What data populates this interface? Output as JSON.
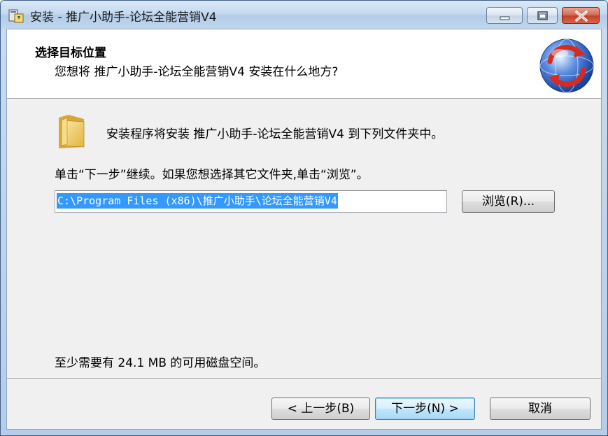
{
  "window": {
    "title": "安装 - 推广小助手-论坛全能营销V4"
  },
  "header": {
    "title": "选择目标位置",
    "subtitle": "您想将 推广小助手-论坛全能营销V4 安装在什么地方?"
  },
  "body": {
    "intro": "安装程序将安装 推广小助手-论坛全能营销V4 到下列文件夹中。",
    "hint": "单击“下一步”继续。如果您想选择其它文件夹,单击“浏览”。",
    "path_value": "C:\\Program Files (x86)\\推广小助手\\论坛全能营销V4",
    "browse_label": "浏览(R)...",
    "space_required": "至少需要有 24.1 MB 的可用磁盘空间。"
  },
  "footer": {
    "back_label": "< 上一步(B)",
    "next_label": "下一步(N) >",
    "cancel_label": "取消"
  },
  "icons": {
    "app": "installer-icon",
    "logo": "globe-refresh-icon",
    "folder": "folder-icon"
  },
  "colors": {
    "selection": "#3399ff",
    "accent_button": "#bee6fd",
    "close_button": "#c0432a"
  }
}
